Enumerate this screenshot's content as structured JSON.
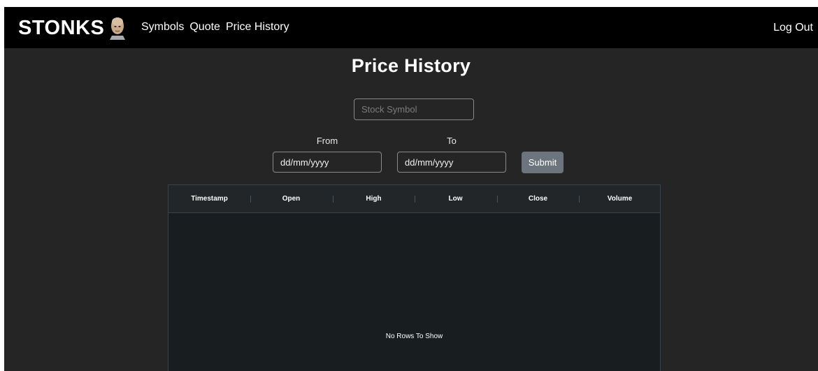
{
  "navbar": {
    "brand": "STONKS",
    "links": [
      {
        "label": "Symbols"
      },
      {
        "label": "Quote"
      },
      {
        "label": "Price History"
      }
    ],
    "logout_label": "Log Out"
  },
  "page": {
    "title": "Price History"
  },
  "search": {
    "placeholder": "Stock Symbol"
  },
  "date_range": {
    "from_label": "From",
    "to_label": "To",
    "from_placeholder": "dd/mm/yyyy",
    "to_placeholder": "dd/mm/yyyy"
  },
  "submit_label": "Submit",
  "table": {
    "columns": [
      "Timestamp",
      "Open",
      "High",
      "Low",
      "Close",
      "Volume"
    ],
    "empty_message": "No Rows To Show"
  },
  "colors": {
    "navbar_bg": "#000000",
    "page_bg": "#252525",
    "grid_bg": "#181d1f",
    "grid_header_bg": "#222628",
    "button_bg": "#6c757d"
  }
}
